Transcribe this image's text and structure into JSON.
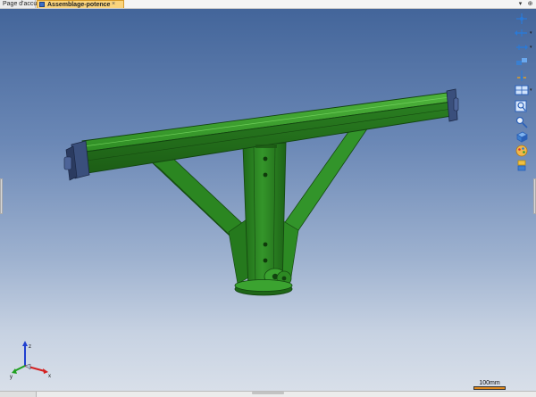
{
  "tabs": {
    "home_label": "Page d'accueil",
    "active_label": "Assemblage-potence",
    "close_glyph": "×"
  },
  "window": {
    "collapse_glyph": "▾",
    "pin_glyph": "⊕"
  },
  "toolbar": {
    "icons": [
      "view-orientation-icon",
      "view-axis-icon",
      "section-view-icon",
      "hide-show-icon",
      "point-icon",
      "display-style-icon",
      "zoom-window-icon",
      "zoom-fit-icon",
      "box-view-icon",
      "appearance-icon",
      "lighting-icon"
    ],
    "dropdown_glyph": "▾"
  },
  "model": {
    "name": "Assemblage-potence",
    "color": "#2d8a22",
    "dark_color": "#1b5c14",
    "light_color": "#4cae39"
  },
  "axes": {
    "x_label": "x",
    "y_label": "y",
    "z_label": "z",
    "x_color": "#d42020",
    "y_color": "#20a020",
    "z_color": "#2040d0"
  },
  "scale": {
    "label": "100mm",
    "color": "#e08a1e"
  },
  "viewport": {
    "bg_top": "#43659a",
    "bg_bottom": "#d8dfe9"
  }
}
